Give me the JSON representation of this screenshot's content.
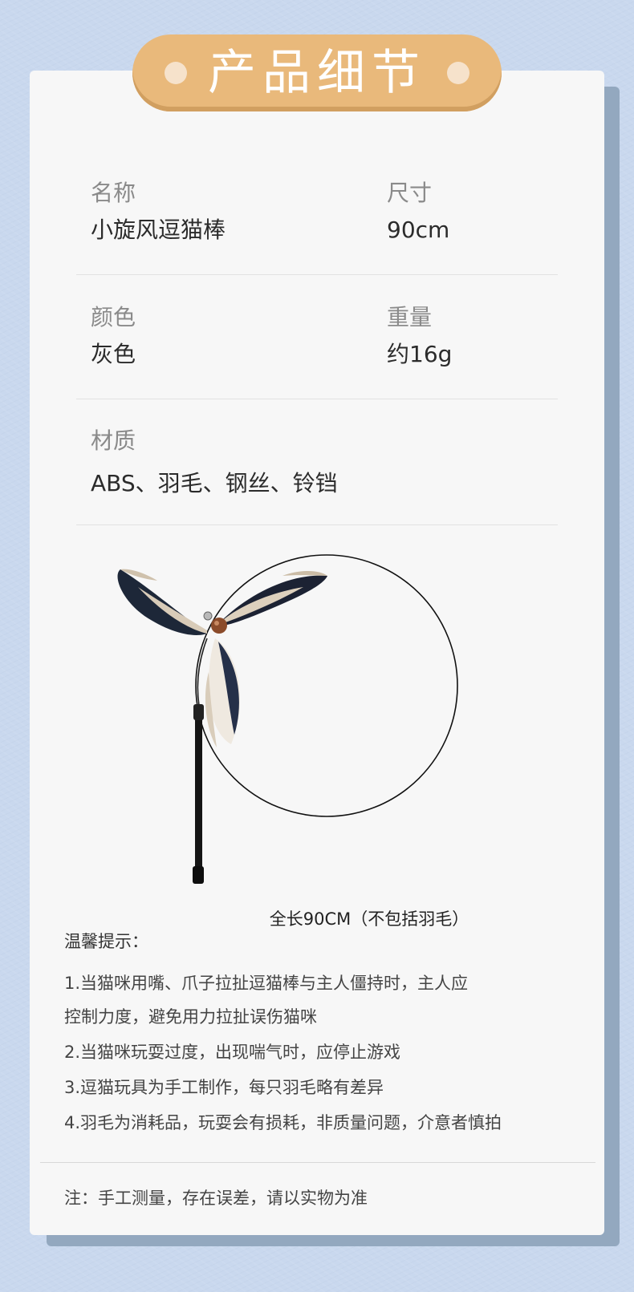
{
  "title": "产品细节",
  "specs": {
    "name_label": "名称",
    "name_value": "小旋风逗猫棒",
    "size_label": "尺寸",
    "size_value": "90cm",
    "color_label": "颜色",
    "color_value": "灰色",
    "weight_label": "重量",
    "weight_value": "约16g",
    "material_label": "材质",
    "material_value": "ABS、羽毛、钢丝、铃铛"
  },
  "product": {
    "caption": "全长90CM（不包括羽毛）",
    "icon": "feather-cat-wand"
  },
  "tips": {
    "title": "温馨提示：",
    "lines": [
      "1.当猫咪用嘴、爪子拉扯逗猫棒与主人僵持时，主人应",
      "控制力度，避免用力拉扯误伤猫咪",
      "2.当猫咪玩耍过度，出现喘气时，应停止游戏",
      "3.逗猫玩具为手工制作，每只羽毛略有差异",
      "4.羽毛为消耗品，玩耍会有损耗，非质量问题，介意者慎拍"
    ]
  },
  "note": "注：手工测量，存在误差，请以实物为准",
  "colors": {
    "background": "#c9d8ee",
    "card": "#f7f7f7",
    "title_pill": "#e9b97b",
    "shadow": "#93a8bf"
  }
}
